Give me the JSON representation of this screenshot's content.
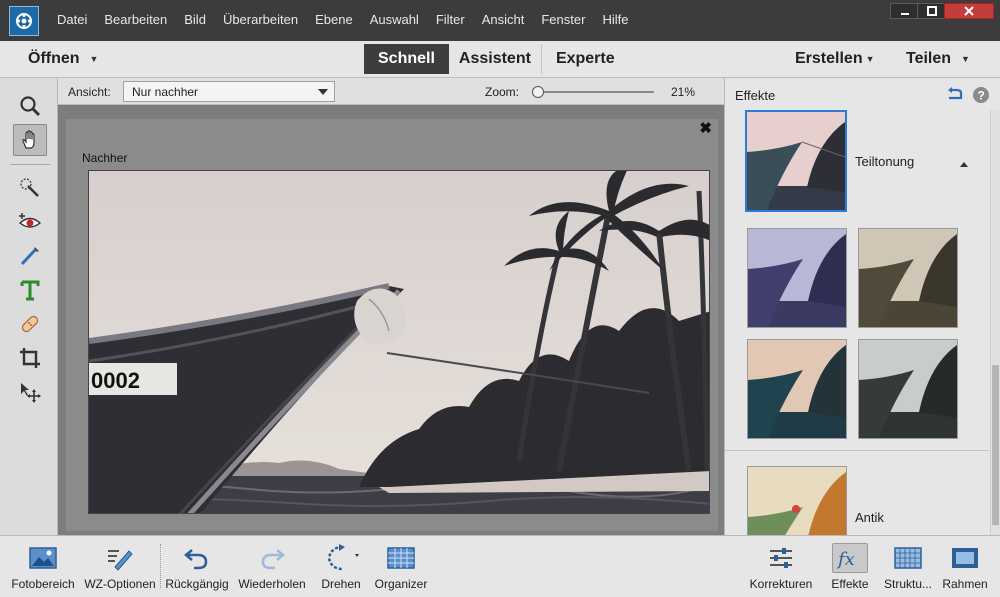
{
  "menu": {
    "items": [
      "Datei",
      "Bearbeiten",
      "Bild",
      "Überarbeiten",
      "Ebene",
      "Auswahl",
      "Filter",
      "Ansicht",
      "Fenster",
      "Hilfe"
    ]
  },
  "modebar": {
    "open_label": "Öffnen",
    "modes": [
      "Schnell",
      "Assistent",
      "Experte"
    ],
    "create_label": "Erstellen",
    "share_label": "Teilen"
  },
  "options": {
    "view_label": "Ansicht:",
    "view_value": "Nur nachher",
    "zoom_label": "Zoom:",
    "zoom_value": "21%",
    "zoom_level": 0.02
  },
  "document": {
    "label": "Nachher",
    "close_glyph": "✖"
  },
  "panel": {
    "title": "Effekte",
    "sections": [
      {
        "name": "Teiltonung"
      },
      {
        "name": "Antik"
      }
    ]
  },
  "bottombar": {
    "photo_bin": "Fotobereich",
    "tool_options": "WZ-Optionen",
    "undo": "Rückgängig",
    "redo": "Wiederholen",
    "rotate": "Drehen",
    "organizer": "Organizer",
    "adjustments": "Korrekturen",
    "effects": "Effekte",
    "textures": "Struktu...",
    "frames": "Rahmen"
  },
  "photo": {
    "boat_number": "0002"
  },
  "colors": {
    "accent": "#2e7ad8",
    "titlebar": "#3c3c3c",
    "active_mode": "#3d3d3d"
  }
}
